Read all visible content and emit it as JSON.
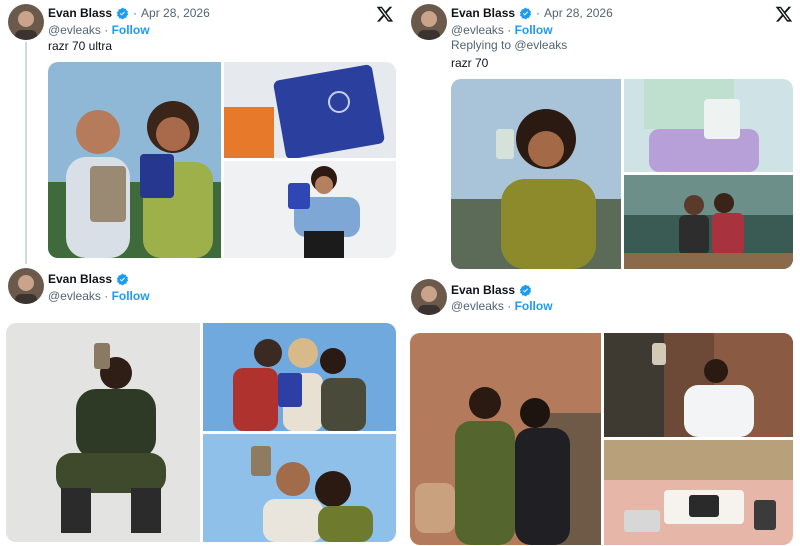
{
  "tweets": [
    {
      "author": "Evan Blass",
      "date": "Apr 28, 2026",
      "handle": "@evleaks",
      "follow_label": "Follow",
      "text": "razr 70 ultra",
      "images": [
        "person holding wood-finish folding phone",
        "blue razr phone close-up",
        "woman posing with blue razr"
      ]
    },
    {
      "author": "Evan Blass",
      "date": "Apr 28, 2026",
      "handle": "@evleaks",
      "follow_label": "Follow",
      "replying_label": "Replying to @evleaks",
      "text": "razr 70",
      "images": [
        "woman speaking to flip phone",
        "purple handbag with phone",
        "friends seated with phone"
      ]
    },
    {
      "author": "Evan Blass",
      "handle": "@evleaks",
      "follow_label": "Follow",
      "images": [
        "man crouching with phone",
        "group selfie with blue razr",
        "couple selfie"
      ]
    },
    {
      "author": "Evan Blass",
      "handle": "@evleaks",
      "follow_label": "Follow",
      "images": [
        "people dancing on street",
        "woman in white jacket with phone",
        "phone on table"
      ]
    }
  ],
  "colors": {
    "accent": "#1d9bf0",
    "text": "#0f1419",
    "muted": "#536471"
  },
  "dot": "·"
}
